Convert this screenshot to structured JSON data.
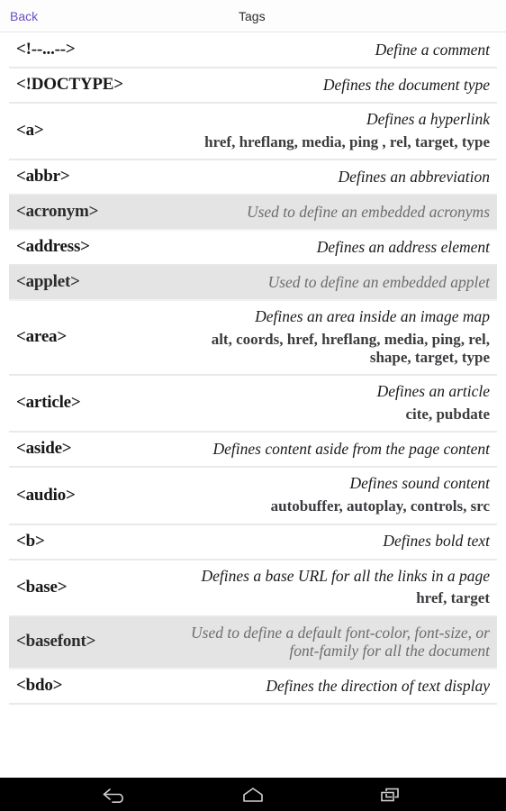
{
  "header": {
    "back_label": "Back",
    "title": "Tags",
    "back_color": "#6b4fc4",
    "title_color": "#2b2b2b"
  },
  "colors": {
    "page_background": "#ffffff",
    "deprecated_row_background": "#e4e4e4",
    "row_separator": "#e9e9e9",
    "description_text": "#1b1b1d",
    "deprecated_text": "#6d6d6d",
    "attribute_text": "#3c3c40",
    "nav_bar_background": "#000000"
  },
  "tag_list": [
    {
      "tag": "<!--...-->",
      "description": "Define a comment",
      "attributes": "",
      "deprecated": false
    },
    {
      "tag": "<!DOCTYPE>",
      "description": "Defines the document type",
      "attributes": "",
      "deprecated": false
    },
    {
      "tag": "<a>",
      "description": "Defines a hyperlink",
      "attributes": "href, hreflang, media, ping , rel, target, type",
      "deprecated": false
    },
    {
      "tag": "<abbr>",
      "description": "Defines an abbreviation",
      "attributes": "",
      "deprecated": false
    },
    {
      "tag": "<acronym>",
      "description": "Used to define an embedded acronyms",
      "attributes": "",
      "deprecated": true
    },
    {
      "tag": "<address>",
      "description": "Defines an address element",
      "attributes": "",
      "deprecated": false
    },
    {
      "tag": "<applet>",
      "description": "Used to define an embedded applet",
      "attributes": "",
      "deprecated": true
    },
    {
      "tag": "<area>",
      "description": "Defines an area inside an image map",
      "attributes": "alt, coords, href, hreflang, media, ping, rel, shape, target, type",
      "deprecated": false
    },
    {
      "tag": "<article>",
      "description": "Defines an article",
      "attributes": "cite,  pubdate",
      "deprecated": false
    },
    {
      "tag": "<aside>",
      "description": "Defines content aside from the page content",
      "attributes": "",
      "deprecated": false
    },
    {
      "tag": "<audio>",
      "description": "Defines sound content",
      "attributes": "autobuffer, autoplay, controls, src",
      "deprecated": false
    },
    {
      "tag": "<b>",
      "description": "Defines bold text",
      "attributes": "",
      "deprecated": false
    },
    {
      "tag": "<base>",
      "description": "Defines a base URL for all the links in a page",
      "attributes": "href,  target",
      "deprecated": false
    },
    {
      "tag": "<basefont>",
      "description": "Used to define a default font-color, font-size, or font-family for all the document",
      "attributes": "",
      "deprecated": true
    },
    {
      "tag": "<bdo>",
      "description": "Defines the direction of text display",
      "attributes": "",
      "deprecated": false
    }
  ],
  "nav_bar": {
    "buttons": [
      {
        "name": "back",
        "label": "Back"
      },
      {
        "name": "home",
        "label": "Home"
      },
      {
        "name": "recents",
        "label": "Recent apps"
      }
    ]
  }
}
